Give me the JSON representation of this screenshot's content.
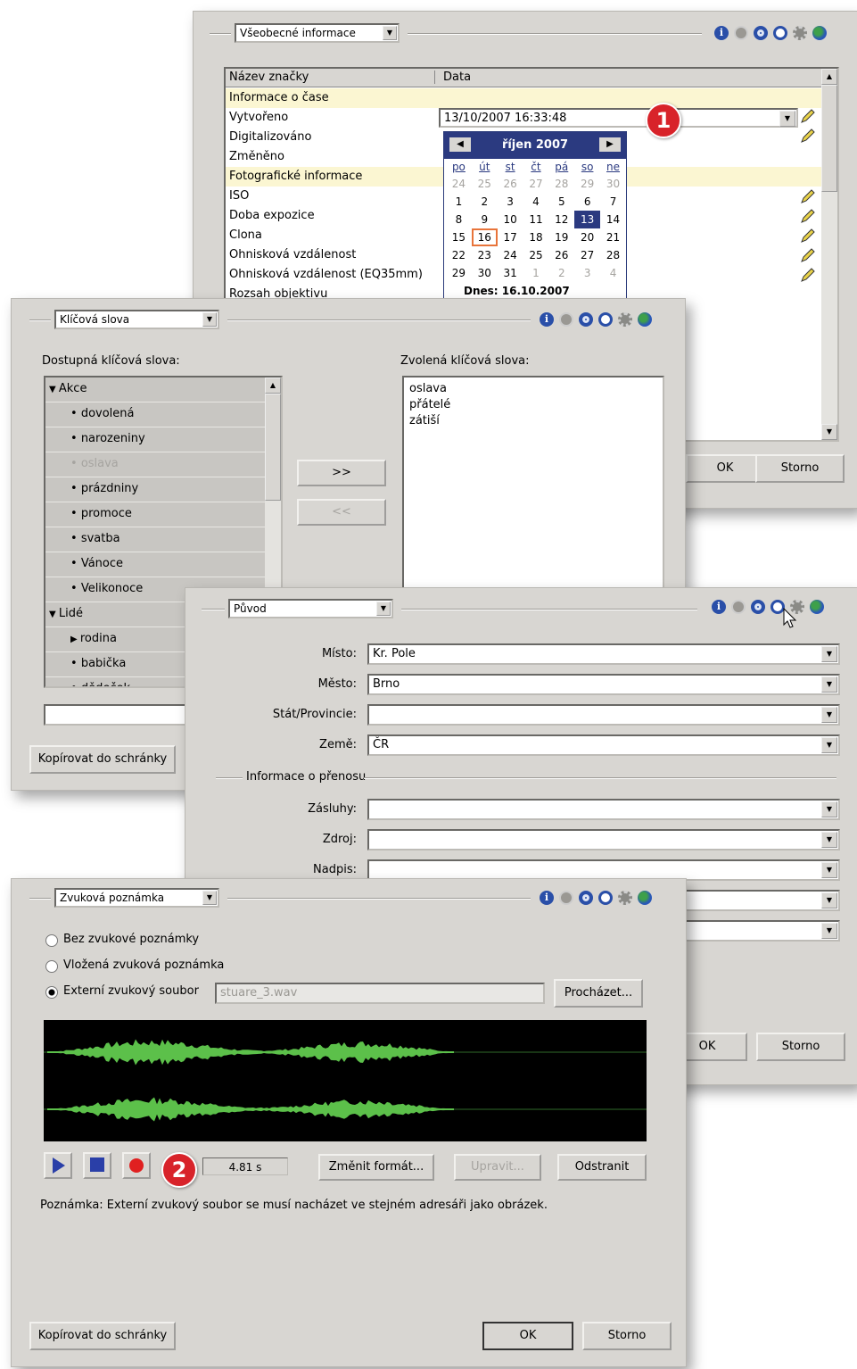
{
  "panel1": {
    "dropdown": "Všeobecné informace",
    "col_headers": [
      "Název značky",
      "Data"
    ],
    "rows": [
      {
        "label": "Informace o čase",
        "section": true
      },
      {
        "label": "Vytvořeno",
        "value": "13/10/2007 16:33:48"
      },
      {
        "label": "Digitalizováno"
      },
      {
        "label": "Změněno"
      },
      {
        "label": "Fotografické informace",
        "section": true
      },
      {
        "label": "ISO"
      },
      {
        "label": "Doba expozice"
      },
      {
        "label": "Clona"
      },
      {
        "label": "Ohnisková vzdálenost"
      },
      {
        "label": "Ohnisková vzdálenost (EQ35mm)"
      },
      {
        "label": "Rozsah objektivu"
      }
    ],
    "calendar": {
      "month": "říjen 2007",
      "weekdays": [
        "po",
        "út",
        "st",
        "čt",
        "pá",
        "so",
        "ne"
      ],
      "weeks": [
        [
          "24",
          "25",
          "26",
          "27",
          "28",
          "29",
          "30"
        ],
        [
          "1",
          "2",
          "3",
          "4",
          "5",
          "6",
          "7"
        ],
        [
          "8",
          "9",
          "10",
          "11",
          "12",
          "13",
          "14"
        ],
        [
          "15",
          "16",
          "17",
          "18",
          "19",
          "20",
          "21"
        ],
        [
          "22",
          "23",
          "24",
          "25",
          "26",
          "27",
          "28"
        ],
        [
          "29",
          "30",
          "31",
          "1",
          "2",
          "3",
          "4"
        ]
      ],
      "selected": "13",
      "today": "16",
      "footer": "Dnes: 16.10.2007"
    },
    "ok": "OK",
    "cancel": "Storno",
    "badge": "1"
  },
  "panel2": {
    "dropdown": "Klíčová slova",
    "available_label": "Dostupná klíčová slova:",
    "selected_label": "Zvolená klíčová slova:",
    "tree": [
      {
        "label": "Akce",
        "group": true
      },
      {
        "label": "dovolená"
      },
      {
        "label": "narozeniny"
      },
      {
        "label": "oslava",
        "disabled": true
      },
      {
        "label": "prázdniny"
      },
      {
        "label": "promoce"
      },
      {
        "label": "svatba"
      },
      {
        "label": "Vánoce"
      },
      {
        "label": "Velikonoce"
      },
      {
        "label": "Lidé",
        "group": true
      },
      {
        "label": "rodina",
        "collapsed": true
      },
      {
        "label": "babička"
      },
      {
        "label": "dědeček"
      }
    ],
    "selected_words": [
      "oslava",
      "přátelé",
      "zátiší"
    ],
    "add_btn": ">>",
    "remove_btn": "<<",
    "copy_btn": "Kopírovat do schránky"
  },
  "panel3": {
    "dropdown": "Původ",
    "fields": [
      {
        "label": "Místo:",
        "value": "Kr. Pole"
      },
      {
        "label": "Město:",
        "value": "Brno"
      },
      {
        "label": "Stát/Provincie:",
        "value": ""
      },
      {
        "label": "Země:",
        "value": "ČR"
      }
    ],
    "section2": "Informace o přenosu",
    "fields2": [
      {
        "label": "Zásluhy:",
        "value": ""
      },
      {
        "label": "Zdroj:",
        "value": ""
      },
      {
        "label": "Nadpis:",
        "value": ""
      }
    ],
    "ok": "OK",
    "cancel": "Storno"
  },
  "panel4": {
    "dropdown": "Zvuková poznámka",
    "radios": [
      "Bez zvukové poznámky",
      "Vložená zvuková poznámka",
      "Externí zvukový soubor"
    ],
    "file": "stuare_3.wav",
    "browse": "Procházet...",
    "time": "4.81 s",
    "change_format": "Změnit formát...",
    "edit": "Upravit...",
    "remove": "Odstranit",
    "note": "Poznámka: Externí zvukový soubor se musí nacházet ve stejném adresáři jako obrázek.",
    "copy_btn": "Kopírovat do schránky",
    "ok": "OK",
    "cancel": "Storno",
    "badge": "2",
    "colors": {
      "wave": "#5cc04a",
      "wave_bg": "#000000"
    }
  }
}
